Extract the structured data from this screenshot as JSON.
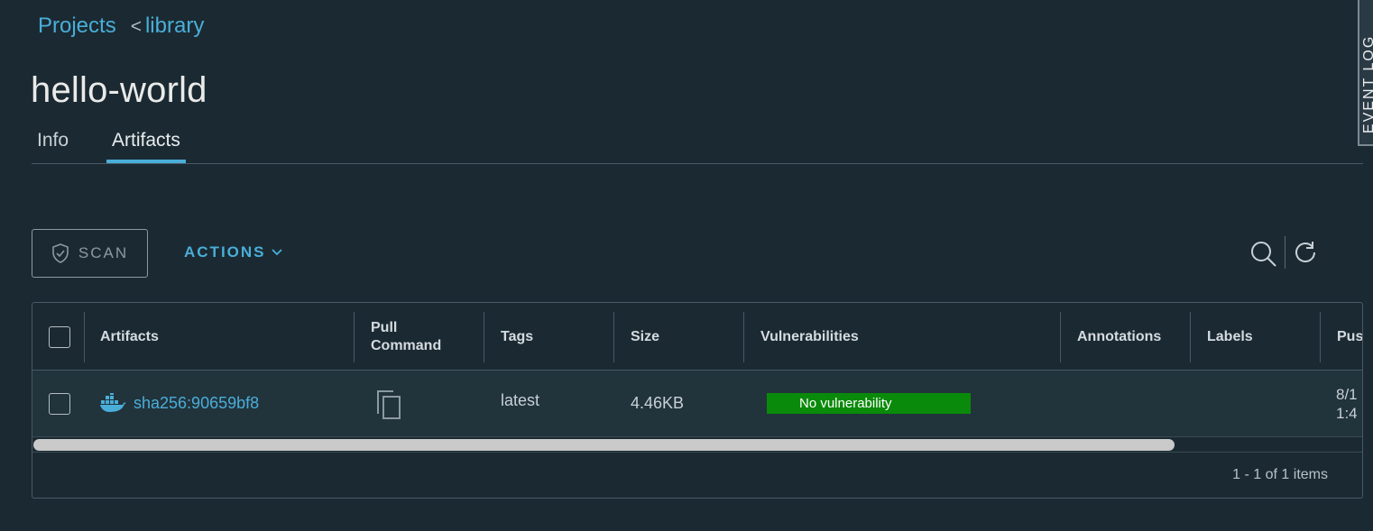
{
  "breadcrumb": {
    "projects": "Projects",
    "separator": "<",
    "library": "library"
  },
  "page_title": "hello-world",
  "tabs": [
    {
      "label": "Info",
      "active": false
    },
    {
      "label": "Artifacts",
      "active": true
    }
  ],
  "event_log_label": "EVENT LOG",
  "toolbar": {
    "scan_label": "SCAN",
    "actions_label": "ACTIONS",
    "scan_icon": "shield-check-icon",
    "search_icon": "search-icon",
    "refresh_icon": "refresh-icon"
  },
  "table": {
    "columns": [
      "Artifacts",
      "Pull Command",
      "Tags",
      "Size",
      "Vulnerabilities",
      "Annotations",
      "Labels",
      "Pus"
    ],
    "rows": [
      {
        "artifact": "sha256:90659bf8",
        "artifact_icon": "docker-icon",
        "pull_command_icon": "copy-icon",
        "tags": "latest",
        "size": "4.46KB",
        "vulnerabilities": "No vulnerability",
        "annotations": "",
        "labels": "",
        "pushed_line1": "8/1",
        "pushed_line2": "1:4"
      }
    ],
    "footer": "1 - 1 of 1 items",
    "horizontal_scroll_fraction": 0.86
  },
  "colors": {
    "background": "#1b2a32",
    "accent": "#4aaed9",
    "vulnerability_ok": "#0a8a0a"
  }
}
